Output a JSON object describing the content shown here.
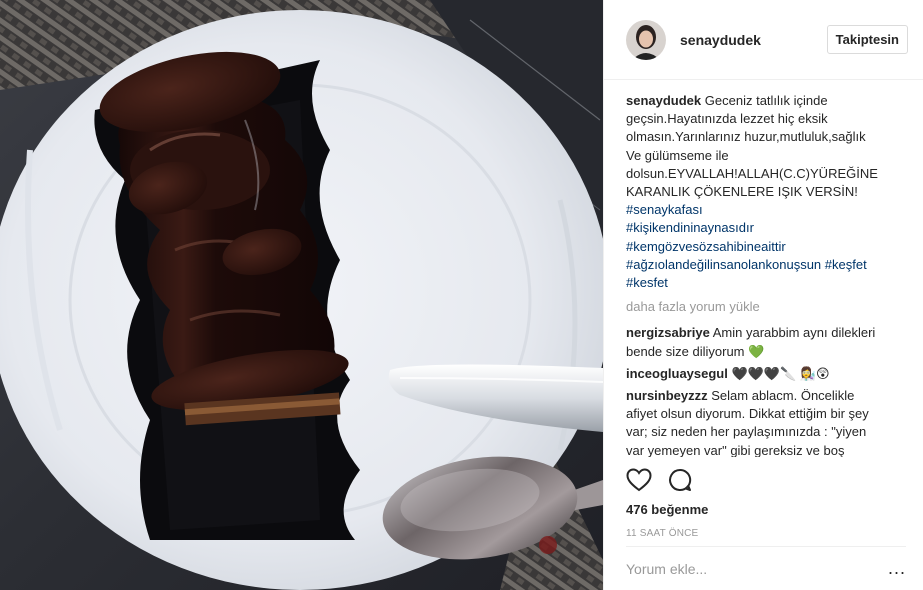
{
  "post": {
    "author": "senaydudek",
    "follow_label": "Takiptesin",
    "caption_user": "senaydudek",
    "caption_lines": [
      "Geceniz tatlılık içinde",
      "geçsin.Hayatınızda lezzet hiç eksik",
      "olmasın.Yarınlarınız huzur,mutluluk,sağlık",
      "Ve gülümseme ile",
      "dolsun.EYVALLAH!ALLAH(C.C)YÜREĞİNE",
      "KARANLIK ÇÖKENLERE IŞIK VERSİN!"
    ],
    "hashtags": [
      "#senaykafası",
      "#kişikendininaynasıdır",
      "#kemgözvesözsahibineaittir",
      "#ağzıolandeğilinsanolankonuşsun #keşfet",
      "#kesfet"
    ],
    "load_more": "daha fazla yorum yükle",
    "comments": [
      {
        "user": "nergizsabriye",
        "text_1": "Amin yarabbim aynı dilekleri",
        "text_2": "bende size diliyorum",
        "emoji": "💚"
      },
      {
        "user": "inceogluaysegul",
        "text_1": "🖤🖤🖤🔪 👩‍🔬😲",
        "text_2": "",
        "emoji": ""
      },
      {
        "user": "nursinbeyzzz",
        "text_1": "Selam ablacm. Öncelikle",
        "text_2": "afiyet olsun diyorum. Dikkat ettiğim bir şey",
        "text_3": "var; siz neden her paylaşımınızda : \"yiyen",
        "text_4": "var yemeyen var\" gibi gereksiz ve boş"
      }
    ],
    "likes": "476 beğenme",
    "time": "11 SAAT ÖNCE",
    "comment_placeholder": "Yorum ekle...",
    "more_label": "..."
  },
  "icons": {
    "like": "heart-outline-icon",
    "comment": "speech-bubble-icon",
    "more": "ellipsis-icon"
  },
  "colors": {
    "link": "#003569",
    "muted": "#999999",
    "text": "#262626",
    "border": "#efefef"
  }
}
